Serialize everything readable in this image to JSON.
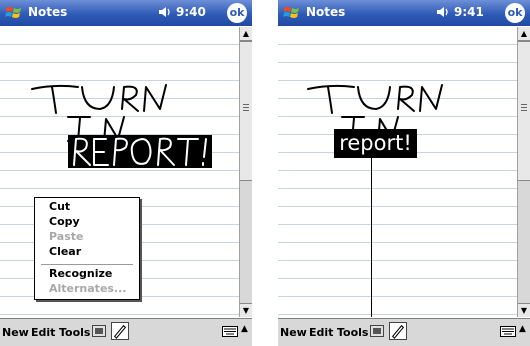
{
  "colors": {
    "titlebar": "#2f5bb7",
    "ink": "#000000",
    "ruled_line": "#c9d3e1"
  },
  "screens": [
    {
      "title": "Notes",
      "time": "9:40",
      "ok": "ok",
      "menu": [
        "New",
        "Edit",
        "Tools"
      ],
      "context_menu": {
        "items": [
          {
            "label": "Cut",
            "enabled": true
          },
          {
            "label": "Copy",
            "enabled": true
          },
          {
            "label": "Paste",
            "enabled": false
          },
          {
            "label": "Clear",
            "enabled": true
          },
          {
            "label": "Recognize",
            "enabled": true
          },
          {
            "label": "Alternates...",
            "enabled": false
          }
        ]
      }
    },
    {
      "title": "Notes",
      "time": "9:41",
      "ok": "ok",
      "menu": [
        "New",
        "Edit",
        "Tools"
      ],
      "recognized_text": "report!"
    }
  ]
}
